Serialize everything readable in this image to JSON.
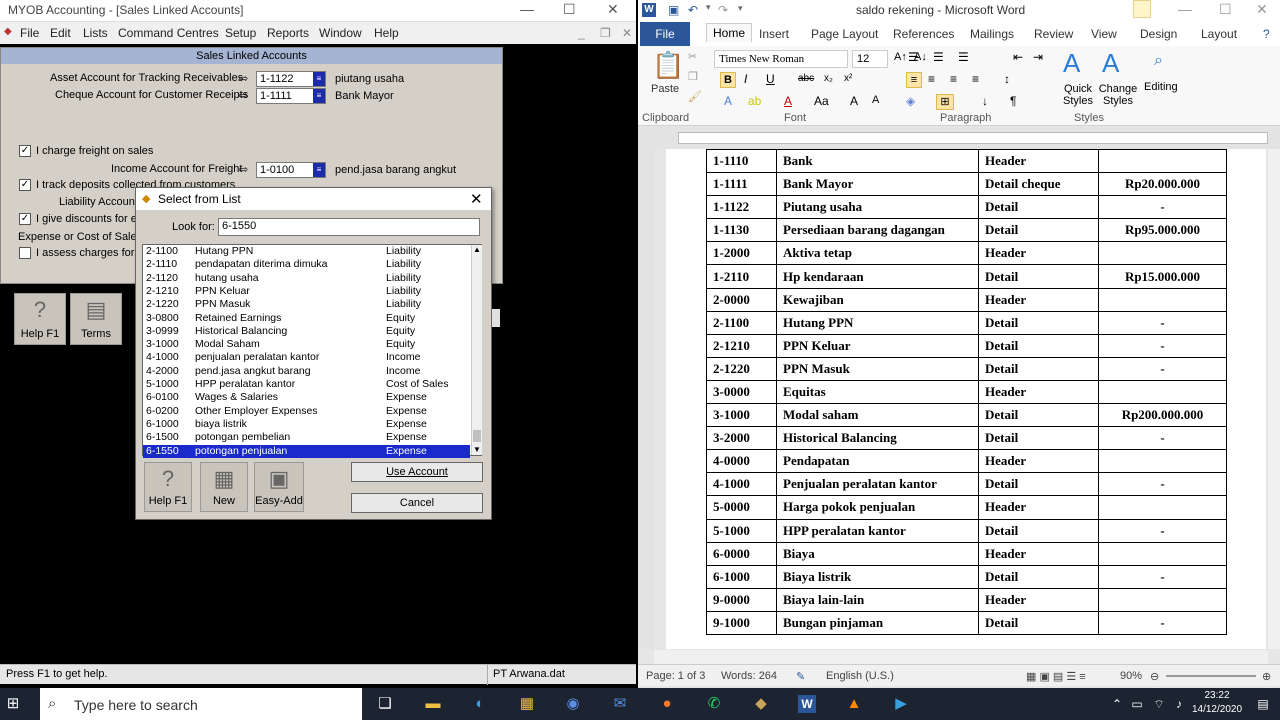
{
  "myob": {
    "title": "MYOB Accounting - [Sales Linked Accounts]",
    "menu": [
      "File",
      "Edit",
      "Lists",
      "Command Centres",
      "Setup",
      "Reports",
      "Window",
      "Help"
    ],
    "sla": {
      "header": "Sales Linked Accounts",
      "asset_label": "Asset Account for Tracking Receivables",
      "asset_value": "1-1122",
      "asset_name": "piutang usaha",
      "cheque_label": "Cheque Account for Customer Receipts",
      "cheque_value": "1-1111",
      "cheque_name": "Bank Mayor",
      "freight_label": "I charge freight on sales",
      "income_freight_label": "Income Account for Freight",
      "income_freight_value": "1-0100",
      "income_freight_name": "pend.jasa barang angkut",
      "deposits_label": "I track deposits collected from customers",
      "liability_label": "Liability Account",
      "discounts_label": "I give discounts for ea",
      "expense_label": "Expense or Cost of Sales A",
      "assess_label": "I assess charges for la",
      "help_label": "Help F1",
      "terms_label": "Terms"
    },
    "select": {
      "title": "Select from List",
      "lookfor_label": "Look for:",
      "lookfor_value": "6-1550",
      "rows": [
        {
          "code": "2-1100",
          "name": "Hutang PPN",
          "type": "Liability"
        },
        {
          "code": "2-1110",
          "name": "pendapatan diterima dimuka",
          "type": "Liability"
        },
        {
          "code": "2-1120",
          "name": "hutang usaha",
          "type": "Liability"
        },
        {
          "code": "2-1210",
          "name": "PPN Keluar",
          "type": "Liability"
        },
        {
          "code": "2-1220",
          "name": "PPN Masuk",
          "type": "Liability"
        },
        {
          "code": "3-0800",
          "name": "Retained Earnings",
          "type": "Equity"
        },
        {
          "code": "3-0999",
          "name": "Historical Balancing",
          "type": "Equity"
        },
        {
          "code": "3-1000",
          "name": "Modal Saham",
          "type": "Equity"
        },
        {
          "code": "4-1000",
          "name": "penjualan peralatan kantor",
          "type": "Income"
        },
        {
          "code": "4-2000",
          "name": "pend.jasa angkut barang",
          "type": "Income"
        },
        {
          "code": "5-1000",
          "name": "HPP peralatan kantor",
          "type": "Cost of Sales"
        },
        {
          "code": "6-0100",
          "name": "Wages & Salaries",
          "type": "Expense"
        },
        {
          "code": "6-0200",
          "name": "Other Employer Expenses",
          "type": "Expense"
        },
        {
          "code": "6-1000",
          "name": "biaya listrik",
          "type": "Expense"
        },
        {
          "code": "6-1500",
          "name": "potongan pembelian",
          "type": "Expense"
        },
        {
          "code": "6-1550",
          "name": "potongan penjualan",
          "type": "Expense"
        }
      ],
      "help_label": "Help F1",
      "new_label": "New",
      "easyadd_label": "Easy-Add",
      "use_label": "Use Account",
      "cancel_label": "Cancel"
    },
    "status_left": "Press F1 to get help.",
    "status_right": "PT Arwana.dat"
  },
  "word": {
    "title": "saldo rekening - Microsoft Word",
    "tabs": [
      "File",
      "Home",
      "Insert",
      "Page Layout",
      "References",
      "Mailings",
      "Review",
      "View",
      "Design",
      "Layout"
    ],
    "font_name": "Times New Roman",
    "font_size": "12",
    "groups": [
      "Clipboard",
      "Font",
      "Paragraph",
      "Styles"
    ],
    "paste_label": "Paste",
    "quick_styles": "Quick Styles",
    "change_styles": "Change Styles",
    "editing": "Editing",
    "table": [
      [
        "1-1110",
        "Bank",
        "Header",
        ""
      ],
      [
        "1-1111",
        "Bank Mayor",
        "Detail cheque",
        "Rp20.000.000"
      ],
      [
        "1-1122",
        "Piutang usaha",
        "Detail",
        "-"
      ],
      [
        "1-1130",
        "Persediaan barang dagangan",
        "Detail",
        "Rp95.000.000"
      ],
      [
        "1-2000",
        "Aktiva tetap",
        "Header",
        ""
      ],
      [
        "1-2110",
        "Hp  kendaraan",
        "Detail",
        "Rp15.000.000"
      ],
      [
        "2-0000",
        "Kewajiban",
        "Header",
        ""
      ],
      [
        "2-1100",
        "Hutang PPN",
        "Detail",
        "-"
      ],
      [
        "2-1210",
        "PPN Keluar",
        "Detail",
        "-"
      ],
      [
        "2-1220",
        "PPN Masuk",
        "Detail",
        "-"
      ],
      [
        "3-0000",
        "Equitas",
        "Header",
        ""
      ],
      [
        "3-1000",
        "Modal  saham",
        "Detail",
        "Rp200.000.000"
      ],
      [
        "3-2000",
        "Historical Balancing",
        "Detail",
        "-"
      ],
      [
        "4-0000",
        "Pendapatan",
        "Header",
        ""
      ],
      [
        "4-1000",
        "Penjualan peralatan kantor",
        "Detail",
        "-"
      ],
      [
        "5-0000",
        "Harga pokok penjualan",
        "Header",
        ""
      ],
      [
        "5-1000",
        "HPP peralatan kantor",
        "Detail",
        "-"
      ],
      [
        "6-0000",
        "Biaya",
        "Header",
        ""
      ],
      [
        "6-1000",
        "Biaya listrik",
        "Detail",
        "-"
      ],
      [
        "9-0000",
        "Biaya lain-lain",
        "Header",
        ""
      ],
      [
        "9-1000",
        "Bungan pinjaman",
        "Detail",
        "-"
      ]
    ],
    "status": {
      "page": "Page: 1 of 3",
      "words": "Words: 264",
      "lang": "English (U.S.)",
      "zoom": "90%"
    }
  },
  "taskbar": {
    "search_placeholder": "Type here to search",
    "time": "23:22",
    "date": "14/12/2020"
  }
}
